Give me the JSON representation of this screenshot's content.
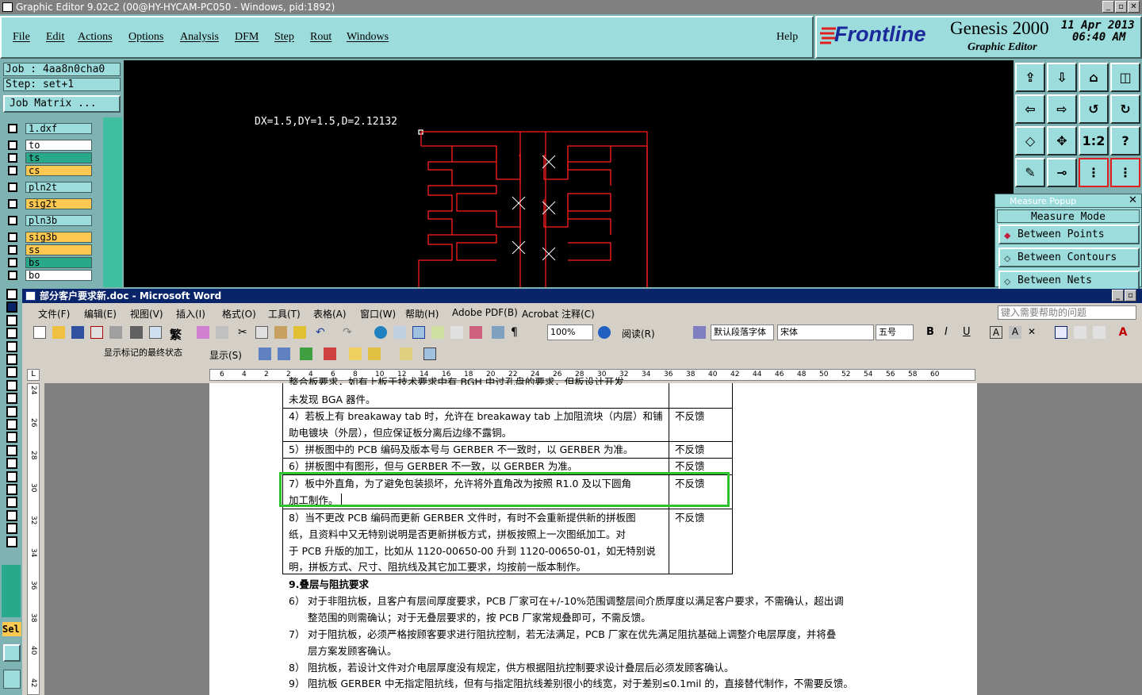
{
  "genesis": {
    "title": "Graphic Editor 9.02c2 (00@HY-HYCAM-PC050 - Windows, pid:1892)",
    "menu": [
      "File",
      "Edit",
      "Actions",
      "Options",
      "Analysis",
      "DFM",
      "Step",
      "Rout",
      "Windows"
    ],
    "help": "Help",
    "brand": "Frontline",
    "product": "Genesis 2000",
    "subtitle": "Graphic Editor",
    "date": "11 Apr 2013",
    "time": "06:40 AM",
    "job": "Job : 4aa8n0cha0",
    "step": "Step: set+1",
    "job_matrix": "Job Matrix ...",
    "measure_readout": "DX=1.5,DY=1.5,D=2.12132",
    "sel_label": "Sel",
    "layers": [
      {
        "name": "1.dxf",
        "color": "#9ddcdc"
      },
      {
        "name": "to",
        "color": "#ffffff"
      },
      {
        "name": "ts",
        "color": "#2aa88a"
      },
      {
        "name": "cs",
        "color": "#ffc850"
      },
      {
        "name": "pln2t",
        "color": "#9ddcdc"
      },
      {
        "name": "sig2t",
        "color": "#ffc850"
      },
      {
        "name": "pln3b",
        "color": "#9ddcdc"
      },
      {
        "name": "sig3b",
        "color": "#ffc850"
      },
      {
        "name": "ss",
        "color": "#ffc850"
      },
      {
        "name": "bs",
        "color": "#2aa88a"
      },
      {
        "name": "bo",
        "color": "#ffffff"
      }
    ],
    "tools": [
      "⇪",
      "⇩",
      "⌂",
      "◫",
      "⇦",
      "⇨",
      "↺",
      "↻",
      "◇",
      "✥",
      "1:2",
      "?",
      "✎",
      "⊸",
      "⋮",
      "⋮"
    ],
    "measure": {
      "title": "Measure Popup",
      "mode_label": "Measure Mode",
      "options": [
        "Between Points",
        "Between Contours",
        "Between Nets"
      ]
    }
  },
  "word": {
    "title": "部分客户要求新.doc - Microsoft Word",
    "menu": [
      "文件(F)",
      "编辑(E)",
      "视图(V)",
      "插入(I)",
      "格式(O)",
      "工具(T)",
      "表格(A)",
      "窗口(W)",
      "帮助(H)",
      "Adobe PDF(B)",
      "Acrobat 注释(C)"
    ],
    "help_box": "键入需要帮助的问题",
    "zoom": "100%",
    "read_btn": "阅读(R)",
    "style": "默认段落字体",
    "font": "宋体",
    "size": "五号",
    "markup_state": "显示标记的最终状态",
    "show_btn": "显示(S)",
    "ruler_ticks": [
      "6",
      "4",
      "2",
      "2",
      "4",
      "6",
      "8",
      "10",
      "12",
      "14",
      "16",
      "18",
      "20",
      "22",
      "24",
      "26",
      "28",
      "30",
      "32",
      "34",
      "36",
      "38",
      "40",
      "42",
      "44",
      "46",
      "48",
      "50",
      "52",
      "54",
      "56",
      "58",
      "60"
    ],
    "vruler_ticks": [
      "24",
      "26",
      "28",
      "30",
      "32",
      "34",
      "36",
      "38",
      "40",
      "42"
    ],
    "table": [
      {
        "text": "整合板要求，如有上板于技术要求中有 BGH 中过孔盘的要求，但板设计开发",
        "text2": "未发现 BGA 器件。",
        "status": ""
      },
      {
        "text": "4）若板上有 breakaway tab 时，允许在 breakaway tab 上加阻流块（内层）和铺",
        "text2": "助电镀块（外层），但应保证板分离后边缘不露铜。",
        "status": "不反馈"
      },
      {
        "text": "5）拼板图中的 PCB 编码及版本号与 GERBER 不一致时，以 GERBER 为准。",
        "text2": "",
        "status": "不反馈"
      },
      {
        "text": "6）拼板图中有图形，但与 GERBER 不一致，以 GERBER 为准。",
        "text2": "",
        "status": "不反馈"
      },
      {
        "text": "7）板中外直角，为了避免包装损坏，允许将外直角改为按照 R1.0 及以下圆角",
        "text2": "加工制作。",
        "status": "不反馈"
      },
      {
        "text": "8）当不更改 PCB 编码而更新 GERBER 文件时，有时不会重新提供新的拼板图",
        "text2": "纸，且资料中又无特别说明是否更新拼板方式，拼板按照上一次图纸加工。对",
        "text3": "于 PCB 升版的加工，比如从 1120-00650-00 升到 1120-00650-01，如无特别说",
        "text4": "明，拼板方式、尺寸、阻抗线及其它加工要求，均按前一版本制作。",
        "status": "不反馈"
      }
    ],
    "heading": "9.叠层与阻抗要求",
    "paras": [
      {
        "num": "6）",
        "l1": "对于非阻抗板，且客户有层间厚度要求，PCB 厂家可在+/-10%范围调整层间介质厚度以满足客户要求，不需确认，超出调",
        "l2": "整范围的则需确认；对于无叠层要求的，按 PCB 厂家常规叠即可，不需反馈。"
      },
      {
        "num": "7）",
        "l1": "对于阻抗板，必须严格按顾客要求进行阻抗控制，若无法满足，PCB 厂家在优先满足阻抗基础上调整介电层厚度，并将叠",
        "l2": "层方案发顾客确认。"
      },
      {
        "num": "8）",
        "l1": "阻抗板，若设计文件对介电层厚度没有规定，供方根据阻抗控制要求设计叠层后必须发顾客确认。",
        "l2": ""
      },
      {
        "num": "9）",
        "l1": "阻抗板 GERBER 中无指定阻抗线，但有与指定阻抗线差别很小的线宽，对于差别≤0.1mil 的，直接替代制作，不需要反馈。",
        "l2": ""
      }
    ]
  }
}
